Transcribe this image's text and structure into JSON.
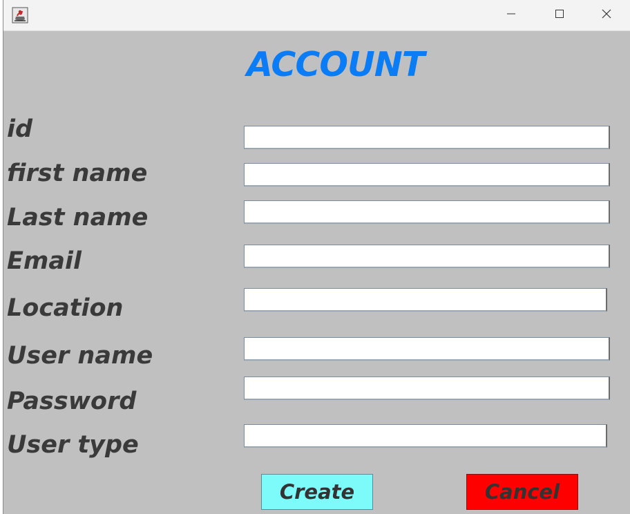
{
  "window": {
    "title_icon": "java-cup-icon",
    "controls": {
      "minimize": "minimize-icon",
      "maximize": "maximize-icon",
      "close": "close-icon"
    }
  },
  "form": {
    "title": "ACCOUNT",
    "fields": [
      {
        "label": " id",
        "value": ""
      },
      {
        "label": "first name",
        "value": ""
      },
      {
        "label": "Last name",
        "value": ""
      },
      {
        "label": "Email",
        "value": ""
      },
      {
        "label": "Location",
        "value": ""
      },
      {
        "label": "User name",
        "value": ""
      },
      {
        "label": "Password",
        "value": ""
      },
      {
        "label": "User type",
        "value": ""
      }
    ],
    "buttons": {
      "create": "Create",
      "cancel": "Cancel"
    }
  },
  "colors": {
    "background": "#c0c0c0",
    "title": "#0a7cf5",
    "create_button": "#7dfbfb",
    "cancel_button": "#ff0000"
  }
}
